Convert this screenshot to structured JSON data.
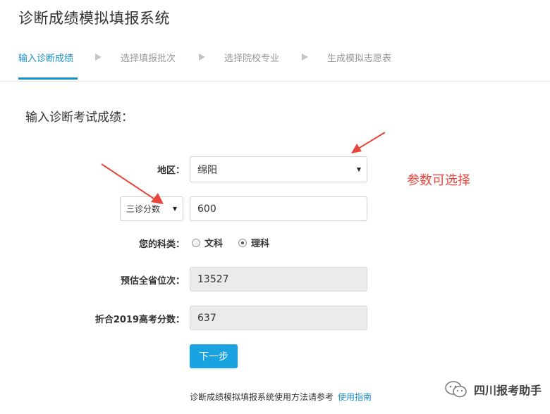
{
  "app": {
    "title": "诊断成绩模拟填报系统"
  },
  "steps": [
    {
      "label": "输入诊断成绩",
      "active": true
    },
    {
      "label": "选择填报批次",
      "active": false
    },
    {
      "label": "选择院校专业",
      "active": false
    },
    {
      "label": "生成模拟志愿表",
      "active": false
    }
  ],
  "form": {
    "heading": "输入诊断考试成绩：",
    "region_label": "地区：",
    "region_value": "绵阳",
    "exam_type_value": "三诊分数",
    "score_value": "600",
    "subject_label": "您的科类：",
    "subject_options": [
      {
        "label": "文科",
        "checked": false
      },
      {
        "label": "理科",
        "checked": true
      }
    ],
    "rank_label": "预估全省位次：",
    "rank_value": "13527",
    "converted_label": "折合2019高考分数：",
    "converted_value": "637",
    "next_label": "下一步"
  },
  "footer": {
    "text": "诊断成绩模拟填报系统使用方法请参考",
    "link": "使用指南"
  },
  "annotation": {
    "text": "参数可选择",
    "color": "#e8463c"
  },
  "watermark": {
    "text": "四川报考助手",
    "icon": "wechat-icon"
  },
  "colors": {
    "accent": "#1a90c8",
    "button": "#1aa3e0",
    "annotation": "#e8463c"
  }
}
